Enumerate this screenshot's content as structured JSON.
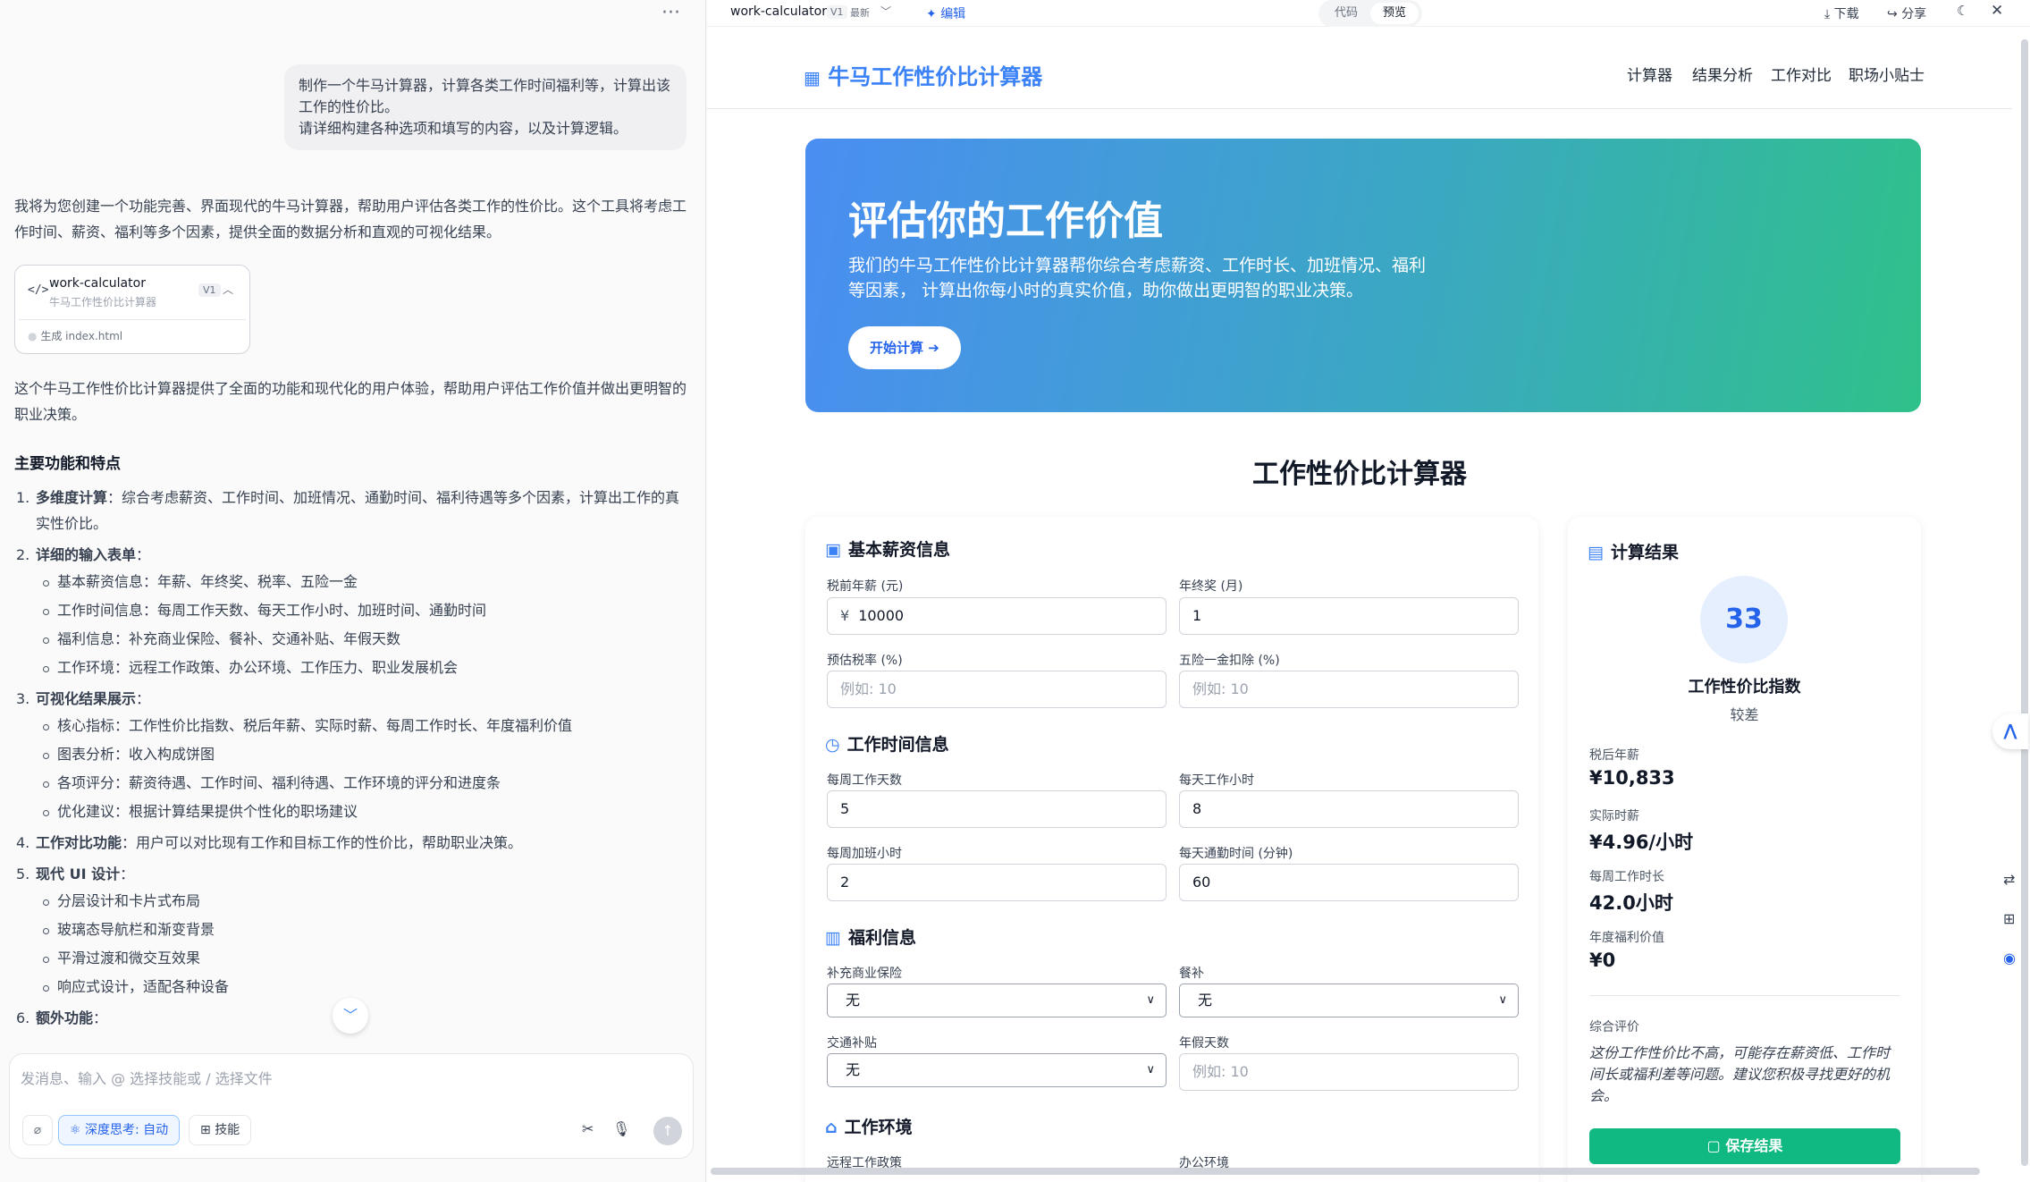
{
  "chat": {
    "more": "···",
    "user_message": [
      "制作一个牛马计算器，计算各类工作时间福利等，计算出该工作的性价比。",
      "请详细构建各种选项和填写的内容，以及计算逻辑。"
    ],
    "intro": "我将为您创建一个功能完善、界面现代的牛马计算器，帮助用户评估各类工作的性价比。这个工具将考虑工作时间、薪资、福利等多个因素，提供全面的数据分析和直观的可视化结果。",
    "artifact": {
      "icon": "</>",
      "title": "work-calculator",
      "subtitle": "牛马工作性价比计算器",
      "version": "V1",
      "generated": "生成 index.html"
    },
    "summary": "这个牛马工作性价比计算器提供了全面的功能和现代化的用户体验，帮助用户评估工作价值并做出更明智的职业决策。",
    "features_heading": "主要功能和特点",
    "f1_num": "1.",
    "f1_bold": "多维度计算",
    "f1_text": "：综合考虑薪资、工作时间、加班情况、通勤时间、福利待遇等多个因素，计算出工作的真实性价比。",
    "f2_num": "2.",
    "f2_bold": "详细的输入表单",
    "f2_text": "：",
    "f2_sub": [
      "基本薪资信息：年薪、年终奖、税率、五险一金",
      "工作时间信息：每周工作天数、每天工作小时、加班时间、通勤时间",
      "福利信息：补充商业保险、餐补、交通补贴、年假天数",
      "工作环境：远程工作政策、办公环境、工作压力、职业发展机会"
    ],
    "f3_num": "3.",
    "f3_bold": "可视化结果展示",
    "f3_text": "：",
    "f3_sub": [
      "核心指标：工作性价比指数、税后年薪、实际时薪、每周工作时长、年度福利价值",
      "图表分析：收入构成饼图",
      "各项评分：薪资待遇、工作时间、福利待遇、工作环境的评分和进度条",
      "优化建议：根据计算结果提供个性化的职场建议"
    ],
    "f4_num": "4.",
    "f4_bold": "工作对比功能",
    "f4_text": "：用户可以对比现有工作和目标工作的性价比，帮助职业决策。",
    "f5_num": "5.",
    "f5_bold": "现代 UI 设计",
    "f5_text": "：",
    "f5_sub": [
      "分层设计和卡片式布局",
      "玻璃态导航栏和渐变背景",
      "平滑过渡和微交互效果",
      "响应式设计，适配各种设备"
    ],
    "f6_num": "6.",
    "f6_bold": "额外功能",
    "f6_text": "：",
    "input_placeholder": "发消息、输入 @ 选择技能或 / 选择文件",
    "deep_think": "深度思考: 自动",
    "skills": "技能"
  },
  "preview_bar": {
    "name": "work-calculator",
    "version": "V1",
    "latest": "最新",
    "edit": "编辑",
    "tab_code": "代码",
    "tab_preview": "预览",
    "download": "下载",
    "share": "分享"
  },
  "app": {
    "logo": "牛马工作性价比计算器",
    "nav": [
      "计算器",
      "结果分析",
      "工作对比",
      "职场小贴士"
    ],
    "hero_title": "评估你的工作价值",
    "hero_sub": "我们的牛马工作性价比计算器帮你综合考虑薪资、工作时长、加班情况、福利等因素， 计算出你每小时的真实价值，助你做出更明智的职业决策。",
    "hero_btn": "开始计算",
    "section_title": "工作性价比计算器",
    "basic": {
      "title": "基本薪资信息",
      "salary_label": "税前年薪 (元)",
      "salary_value": "10000",
      "currency": "¥",
      "bonus_label": "年终奖 (月)",
      "bonus_value": "1",
      "tax_label": "预估税率 (%)",
      "tax_ph": "例如: 10",
      "insurance_label": "五险一金扣除 (%)",
      "insurance_ph": "例如: 10"
    },
    "time": {
      "title": "工作时间信息",
      "days_label": "每周工作天数",
      "days_value": "5",
      "hours_label": "每天工作小时",
      "hours_value": "8",
      "ot_label": "每周加班小时",
      "ot_value": "2",
      "commute_label": "每天通勤时间 (分钟)",
      "commute_value": "60"
    },
    "benefits": {
      "title": "福利信息",
      "ins_label": "补充商业保险",
      "ins_value": "无",
      "meal_label": "餐补",
      "meal_value": "无",
      "trans_label": "交通补贴",
      "trans_value": "无",
      "leave_label": "年假天数",
      "leave_ph": "例如: 10"
    },
    "env": {
      "title": "工作环境",
      "remote_label": "远程工作政策",
      "office_label": "办公环境"
    },
    "result": {
      "title": "计算结果",
      "score": "33",
      "score_label": "工作性价比指数",
      "score_desc": "较差",
      "after_tax_label": "税后年薪",
      "after_tax": "¥10,833",
      "hourly_label": "实际时薪",
      "hourly": "¥4.96/小时",
      "weekly_label": "每周工作时长",
      "weekly": "42.0小时",
      "benefit_label": "年度福利价值",
      "benefit": "¥0",
      "eval_label": "综合评价",
      "eval_text": "这份工作性价比不高，可能存在薪资低、工作时间长或福利差等问题。建议您积极寻找更好的机会。",
      "save": "保存结果"
    }
  }
}
